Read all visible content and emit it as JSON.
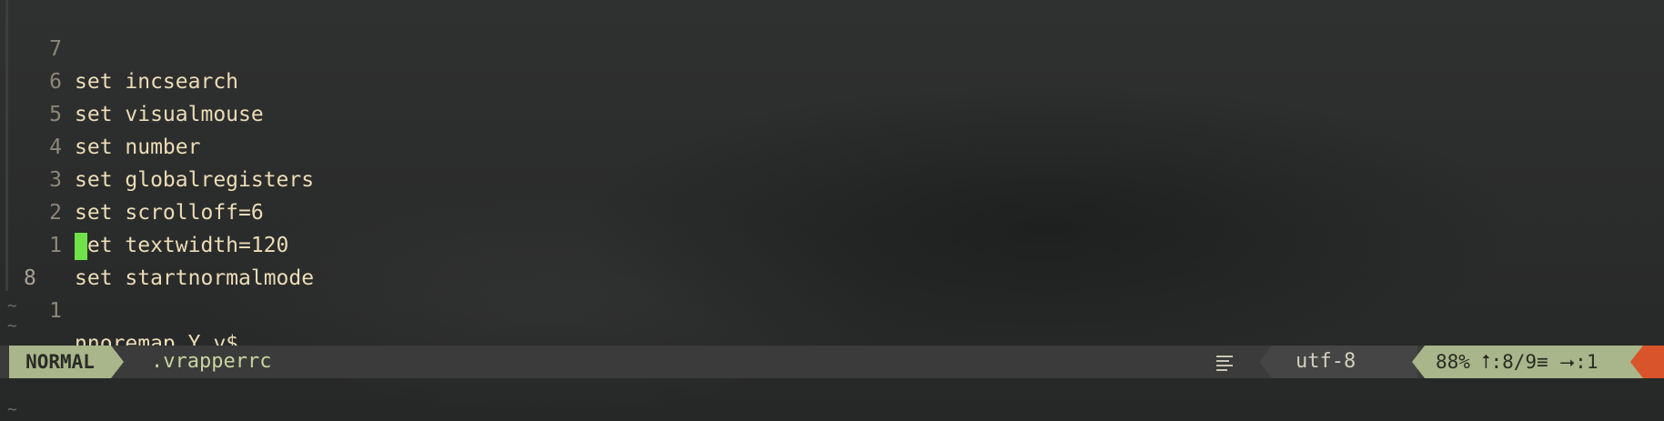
{
  "editor": {
    "lines": [
      {
        "num": "7",
        "text": "set incsearch"
      },
      {
        "num": "6",
        "text": "set visualmouse"
      },
      {
        "num": "5",
        "text": "set number"
      },
      {
        "num": "4",
        "text": "set globalregisters"
      },
      {
        "num": "3",
        "text": "set scrolloff=6"
      },
      {
        "num": "2",
        "text": "set textwidth=120"
      },
      {
        "num": "1",
        "text": "set startnormalmode"
      },
      {
        "num": "8",
        "text": ""
      },
      {
        "num": "1",
        "text": "nnoremap Y y$"
      }
    ],
    "empty_marker": "~"
  },
  "statusline": {
    "mode": "NORMAL",
    "filename": ".vrapperrc",
    "encoding": "utf-8",
    "os_glyph": "",
    "percent": "88%",
    "line_pos": ":8/9",
    "col_pos": ":1",
    "line_icon": "⭡",
    "col_icon": "⭢",
    "lines_icon": "≡"
  },
  "colors": {
    "background": "#2b2c2c",
    "mode_bg": "#a9b58a",
    "cursor": "#6fe24a",
    "warning": "#d9542a"
  }
}
